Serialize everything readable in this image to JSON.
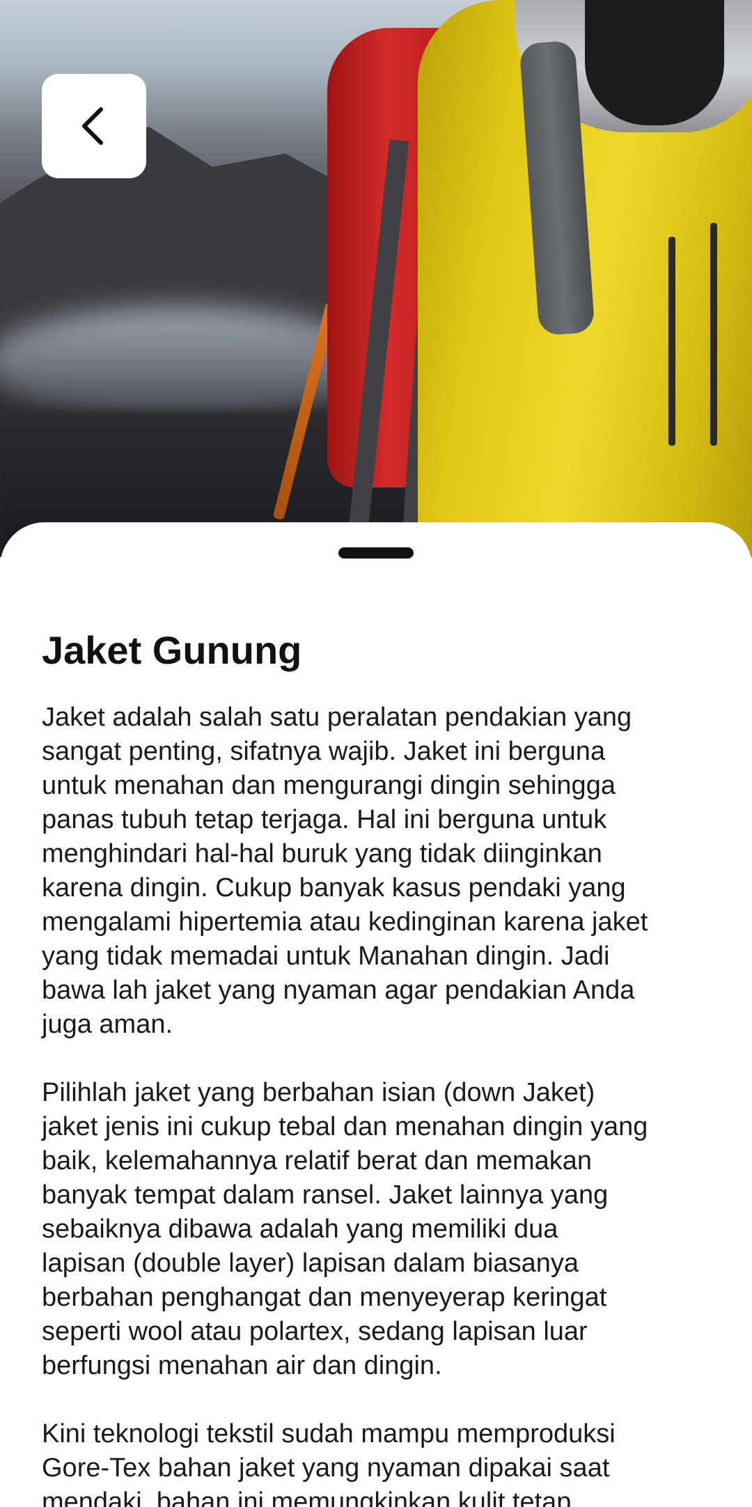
{
  "hero": {
    "image_subject": "hiker-yellow-jacket-red-backpack"
  },
  "back_button": {
    "icon": "chevron-left-icon"
  },
  "article": {
    "title": "Jaket Gunung",
    "paragraphs": [
      "Jaket adalah salah satu peralatan pendakian yang\nsangat penting, sifatnya wajib. Jaket ini berguna\nuntuk menahan dan mengurangi dingin sehingga\npanas tubuh tetap terjaga. Hal ini berguna untuk\nmenghindari hal-hal buruk yang tidak diinginkan\nkarena dingin.  Cukup banyak kasus pendaki yang\nmengalami hipertemia atau kedinginan karena jaket\nyang tidak memadai untuk Manahan dingin. Jadi\nbawa lah jaket yang nyaman agar pendakian Anda\njuga aman.",
      "Pilihlah jaket yang berbahan isian (down Jaket)\njaket jenis ini cukup tebal dan menahan dingin yang\nbaik, kelemahannya relatif berat dan memakan\nbanyak tempat dalam ransel. Jaket lainnya yang\nsebaiknya dibawa adalah yang memiliki dua\nlapisan (double layer) lapisan dalam biasanya\nberbahan penghangat dan menyeyerap keringat\nseperti wool atau polartex, sedang lapisan luar\nberfungsi menahan air dan dingin.",
      "Kini teknologi tekstil sudah mampu memproduksi\nGore-Tex bahan jaket yang nyaman dipakai saat\nmendaki, bahan ini memungkinkan kulit tetap"
    ]
  },
  "colors": {
    "sheet_background": "#ffffff",
    "text": "#1a1a1a",
    "title": "#111111",
    "handle": "#111111"
  }
}
